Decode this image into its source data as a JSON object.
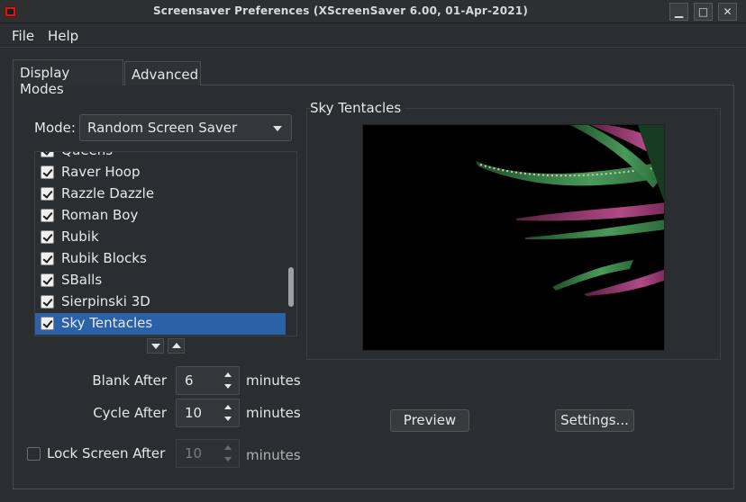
{
  "window": {
    "title": "Screensaver Preferences  (XScreenSaver 6.00, 01-Apr-2021)",
    "minimize_glyph": "▁",
    "maximize_glyph": "□",
    "close_glyph": "✕"
  },
  "menu": {
    "file": "File",
    "help": "Help"
  },
  "tabs": [
    {
      "label": "Display Modes",
      "active": true
    },
    {
      "label": "Advanced",
      "active": false
    }
  ],
  "mode": {
    "label": "Mode:",
    "selected": "Random Screen Saver"
  },
  "list": {
    "items": [
      {
        "label": "Queens",
        "checked": true
      },
      {
        "label": "Raver Hoop",
        "checked": true
      },
      {
        "label": "Razzle Dazzle",
        "checked": true
      },
      {
        "label": "Roman Boy",
        "checked": true
      },
      {
        "label": "Rubik",
        "checked": true
      },
      {
        "label": "Rubik Blocks",
        "checked": true
      },
      {
        "label": "SBalls",
        "checked": true
      },
      {
        "label": "Sierpinski 3D",
        "checked": true
      },
      {
        "label": "Sky Tentacles",
        "checked": true,
        "selected": true
      }
    ],
    "scroll_position": 0.78
  },
  "timing": {
    "blank_after": {
      "label": "Blank After",
      "value": "6",
      "unit": "minutes"
    },
    "cycle_after": {
      "label": "Cycle After",
      "value": "10",
      "unit": "minutes"
    },
    "lock_after": {
      "label": "Lock Screen After",
      "value": "10",
      "unit": "minutes",
      "enabled": false
    }
  },
  "preview": {
    "title": "Sky Tentacles"
  },
  "buttons": {
    "preview": "Preview",
    "settings": "Settings..."
  },
  "colors": {
    "selection": "#2b62a7",
    "background": "#2b2e31",
    "tentacle_green": "#3f8a4c",
    "tentacle_pink": "#b0457f"
  }
}
